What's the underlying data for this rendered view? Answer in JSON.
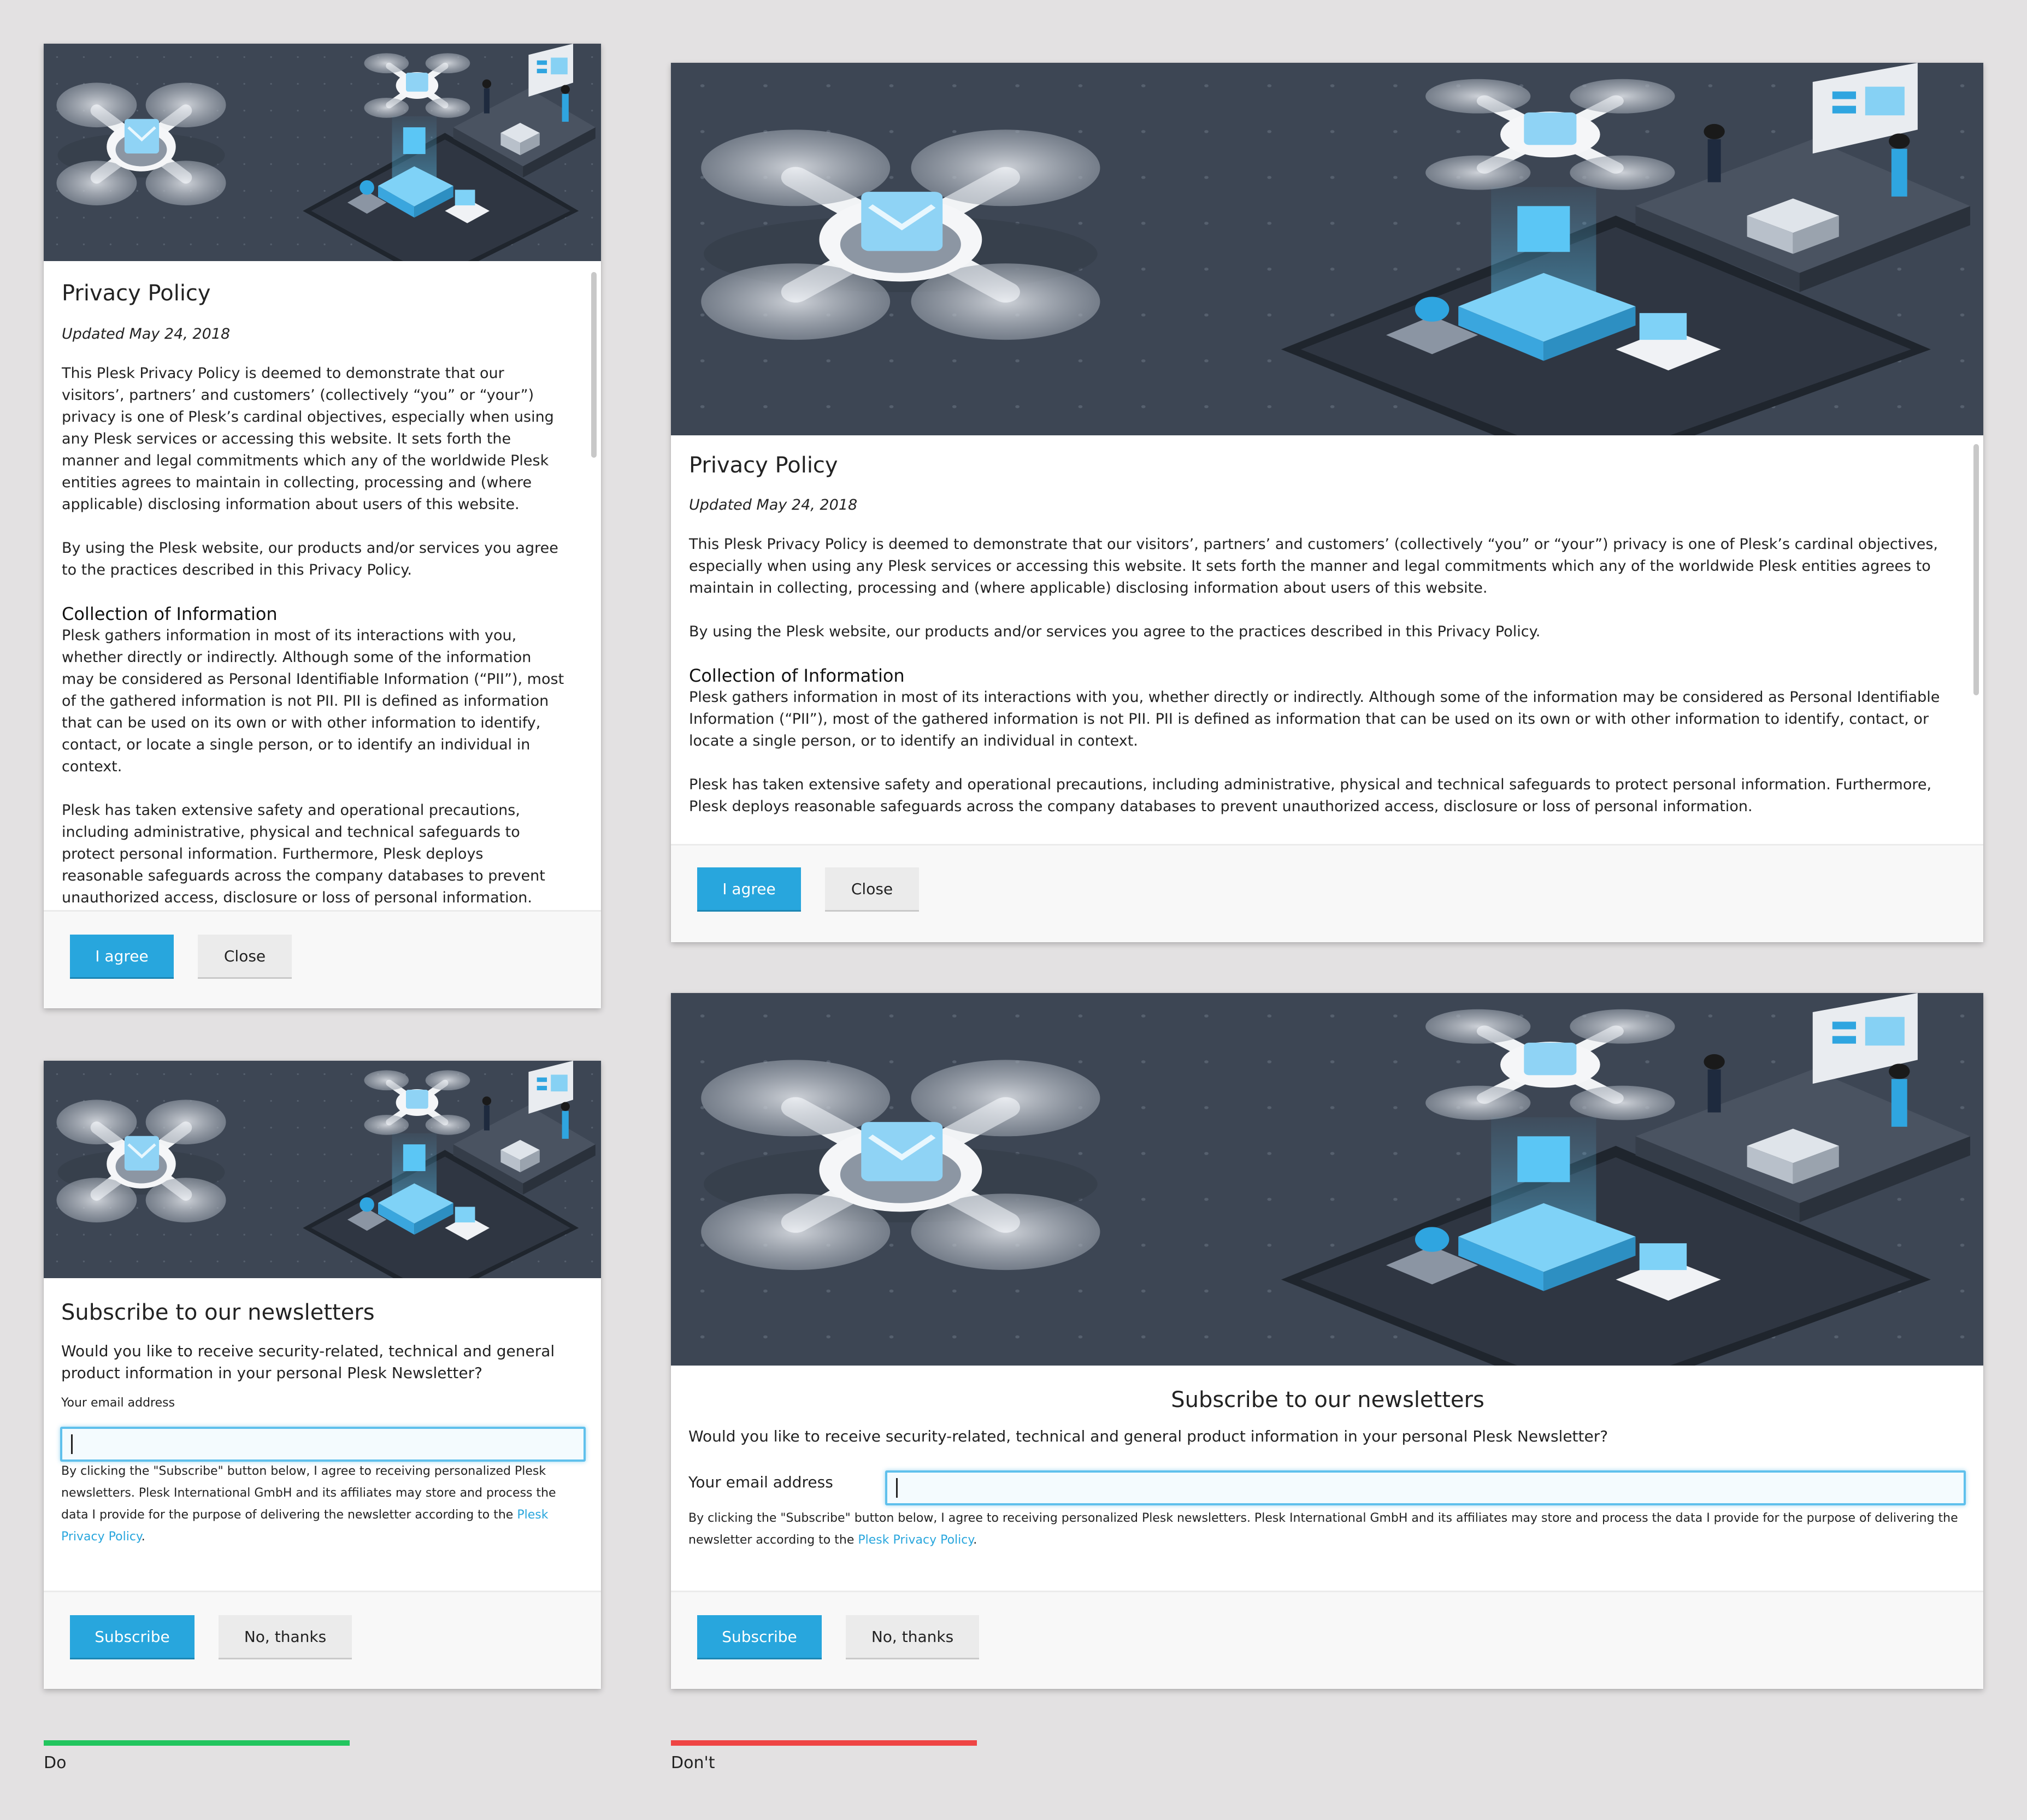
{
  "colors": {
    "page_background": "#e3e1e2",
    "primary_button": "#28a6dd",
    "link": "#28a6dd",
    "do_indicator": "#22c55e",
    "dont_indicator": "#ef4444",
    "hero_background": "#3d4654"
  },
  "privacy": {
    "title": "Privacy Policy",
    "updated": "Updated May 24, 2018",
    "para1": "This Plesk Privacy Policy is deemed to demonstrate that our visitors’, partners’ and customers’ (collectively “you” or “your”) privacy is one of Plesk’s cardinal objectives, especially when using any Plesk services or accessing this website. It sets forth the manner and legal commitments which any of the worldwide Plesk entities agrees to maintain in collecting, processing and (where applicable) disclosing information about users of this website.",
    "para2": "By using the Plesk website, our products and/or services you agree to the practices described in this Privacy Policy.",
    "section_title": "Collection of Information",
    "para3": "Plesk gathers information in most of its interactions with you, whether directly or indirectly. Although some of the information may be considered as Personal Identifiable Information (“PII”), most of the gathered information is not PII. PII is defined as information that can be used on its own or with other information to identify, contact, or locate a single person, or to identify an individual in context.",
    "para4": "Plesk has taken extensive safety and operational precautions, including administrative, physical and technical safeguards to protect personal information. Furthermore, Plesk deploys reasonable safeguards across the company databases to prevent unauthorized access, disclosure or loss of personal information.",
    "agree_label": "I agree",
    "close_label": "Close"
  },
  "newsletter": {
    "title": "Subscribe to our newsletters",
    "question": "Would you like to receive security-related, technical and general product information in your personal Plesk Newsletter?",
    "email_label": "Your email address",
    "email_value": "",
    "consent_text": "By clicking the \"Subscribe\" button below, I agree to receiving personalized Plesk newsletters. Plesk International GmbH and its affiliates may store and process the data I provide for the purpose of delivering the newsletter according to the ",
    "consent_link": "Plesk Privacy Policy",
    "consent_end": ".",
    "subscribe_label": "Subscribe",
    "decline_label": "No, thanks"
  },
  "labels": {
    "do": "Do",
    "dont": "Don't"
  }
}
